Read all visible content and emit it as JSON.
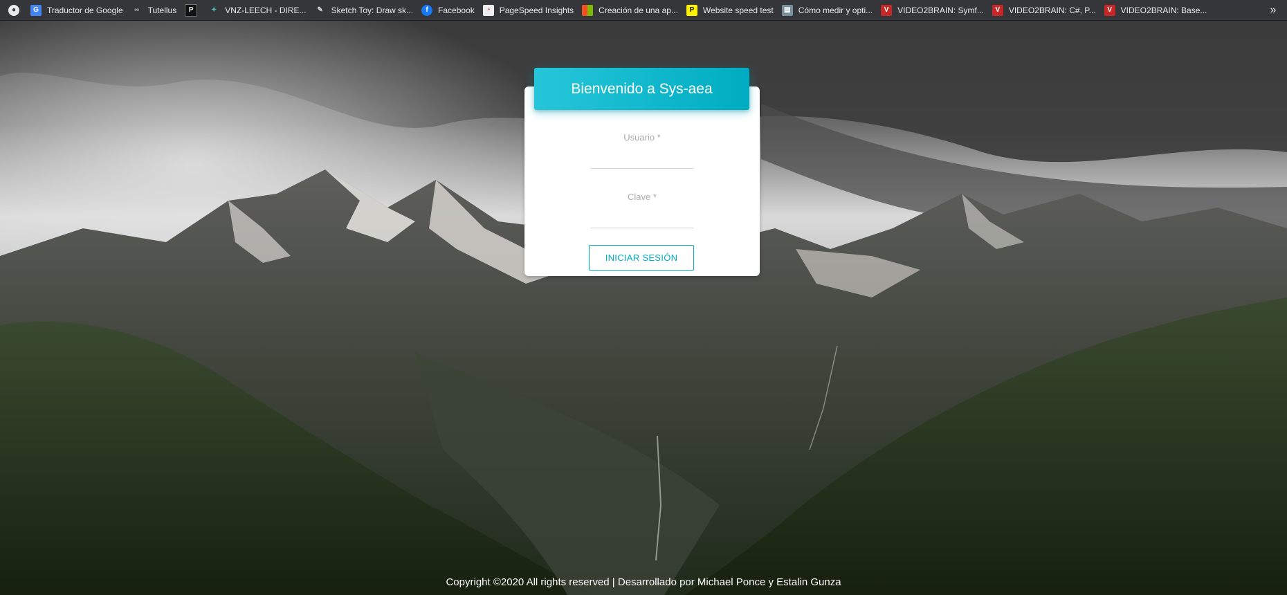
{
  "bookmarks": [
    {
      "label": "",
      "icon": "github-icon"
    },
    {
      "label": "Traductor de Google",
      "icon": "google-translate-icon"
    },
    {
      "label": "Tutellus",
      "icon": "tutellus-icon"
    },
    {
      "label": "",
      "icon": "p-icon"
    },
    {
      "label": "VNZ-LEECH - DIRE...",
      "icon": "vnz-icon"
    },
    {
      "label": "Sketch Toy: Draw sk...",
      "icon": "sketch-icon"
    },
    {
      "label": "Facebook",
      "icon": "facebook-icon"
    },
    {
      "label": "PageSpeed Insights",
      "icon": "pagespeed-icon"
    },
    {
      "label": "Creación de una ap...",
      "icon": "microsoft-icon"
    },
    {
      "label": "Website speed test",
      "icon": "pingdom-icon"
    },
    {
      "label": "Cómo medir y opti...",
      "icon": "article-icon"
    },
    {
      "label": "VIDEO2BRAIN: Symf...",
      "icon": "video2brain-icon"
    },
    {
      "label": "VIDEO2BRAIN: C#, P...",
      "icon": "video2brain-icon"
    },
    {
      "label": "VIDEO2BRAIN: Base...",
      "icon": "video2brain-icon"
    }
  ],
  "bookmarks_more": "»",
  "login": {
    "title": "Bienvenido a Sys-aea",
    "username_label": "Usuario *",
    "username_value": "",
    "password_label": "Clave *",
    "password_value": "",
    "submit_label": "INICIAR SESIÓN"
  },
  "footer": "Copyright ©2020 All rights reserved | Desarrollado por Michael Ponce y Estalin Gunza",
  "colors": {
    "accent": "#00acc1",
    "accent_light": "#26c6da",
    "bookmark_bar": "#35363a"
  }
}
